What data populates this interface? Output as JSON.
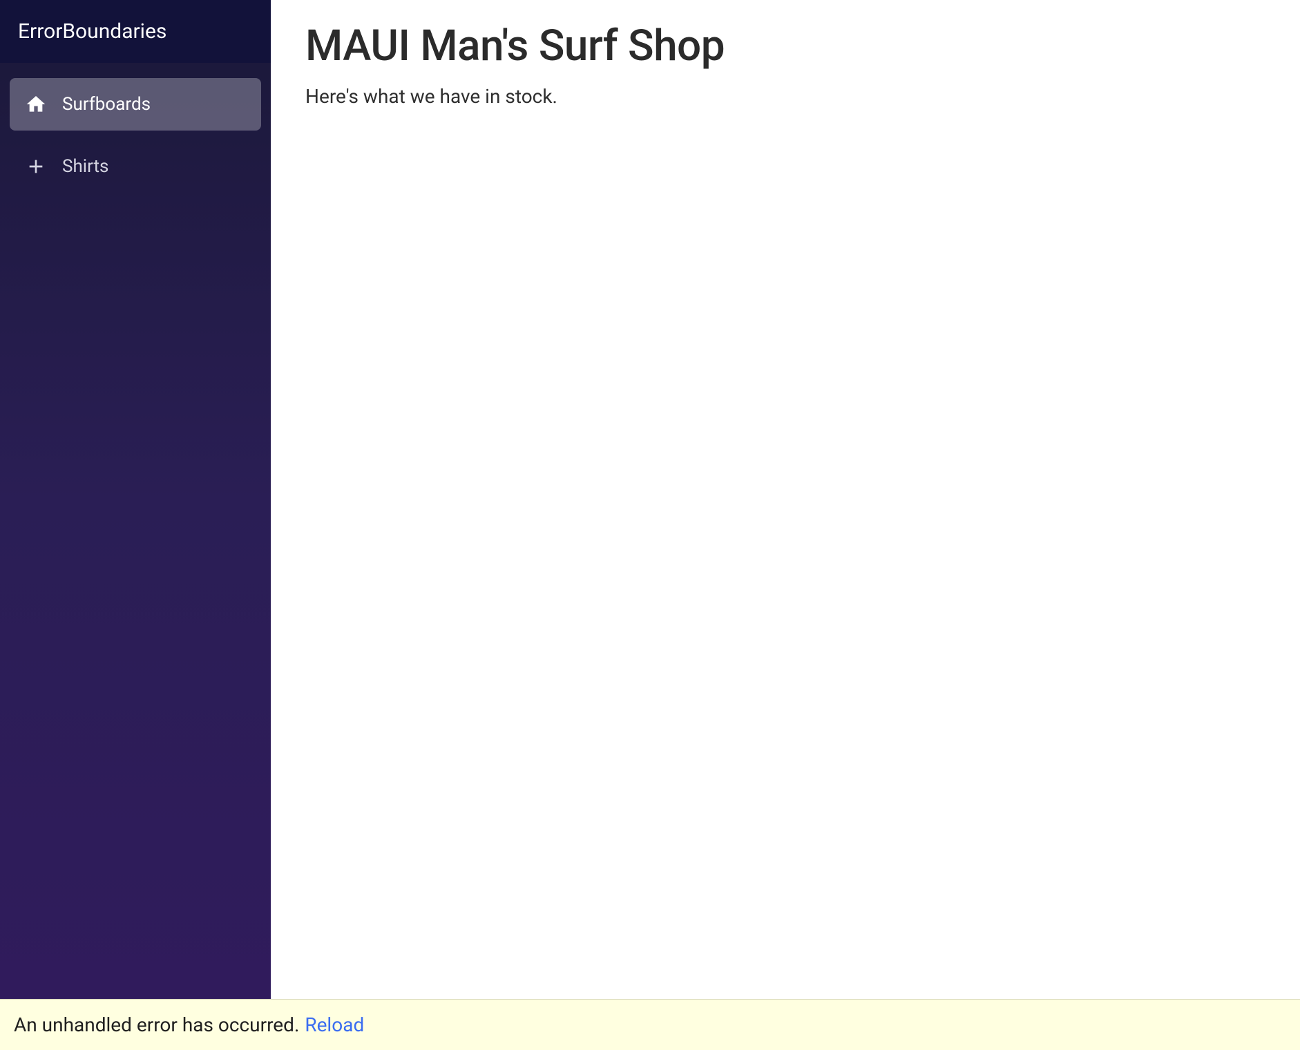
{
  "sidebar": {
    "title": "ErrorBoundaries",
    "items": [
      {
        "label": "Surfboards",
        "icon": "home-icon",
        "active": true
      },
      {
        "label": "Shirts",
        "icon": "plus-icon",
        "active": false
      }
    ]
  },
  "main": {
    "title": "MAUI Man's Surf Shop",
    "subtitle": "Here's what we have in stock."
  },
  "error_bar": {
    "message": "An unhandled error has occurred.",
    "action_label": "Reload"
  }
}
